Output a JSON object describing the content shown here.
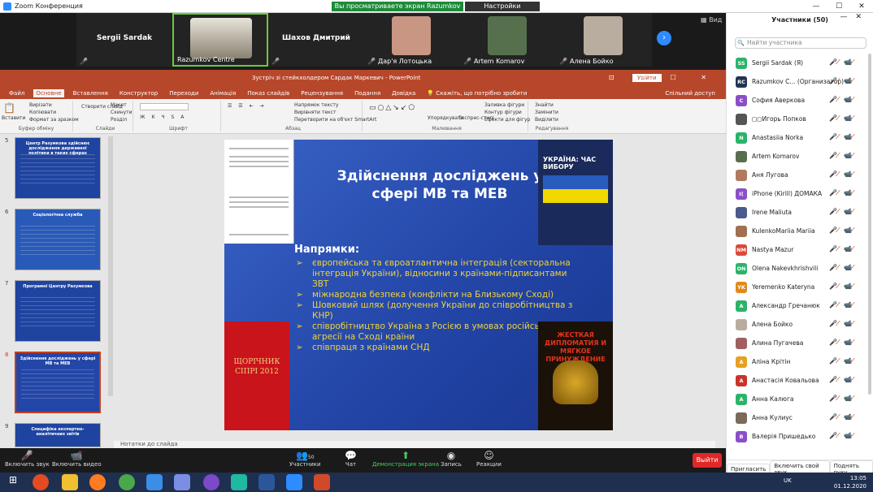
{
  "window": {
    "title": "Zoom Конференция",
    "controls": [
      "—",
      "☐",
      "✕"
    ]
  },
  "share_banner": "Вы просматриваете экран Razumkov Centre",
  "view_options": "Настройки просмотра ⌄",
  "view_button": "Вид",
  "gallery": [
    {
      "name": "Sergii Sardak",
      "label": "",
      "mic_off": true,
      "photo": false
    },
    {
      "name": "",
      "label": "Razumkov Centre",
      "mic_off": false,
      "photo": true,
      "color": "#6a6a60"
    },
    {
      "name": "Шахов Дмитрий",
      "label": "",
      "mic_off": true,
      "photo": false
    },
    {
      "name": "",
      "label": "Дар'я Лотоцька",
      "mic_off": true,
      "photo": true,
      "color": "#c99683"
    },
    {
      "name": "",
      "label": "Artem Komarov",
      "mic_off": true,
      "photo": true,
      "color": "#56704e"
    },
    {
      "name": "",
      "label": "Алена Бойко",
      "mic_off": true,
      "photo": true,
      "color": "#b9ad9f"
    }
  ],
  "ppt": {
    "title": "Зустріч зі стейкхолдером Сардак Маркевич  -  PowerPoint",
    "login": "Увійти",
    "window_controls": "⊡ — ☐ ✕",
    "tabs": [
      "Файл",
      "Основне",
      "Вставлення",
      "Конструктор",
      "Переходи",
      "Анімація",
      "Показ слайдів",
      "Рецензування",
      "Подання",
      "Довідка",
      "💡 Скажіть, що потрібно зробити"
    ],
    "active_tab": "Основне",
    "share_label": "Спільний доступ",
    "ribbon": {
      "clipboard": {
        "label": "Буфер обміну",
        "paste": "Вставити",
        "cut": "Вирізати",
        "copy": "Копіювати",
        "format": "Формат за зразком"
      },
      "slides": {
        "label": "Слайди",
        "new": "Створити слайд",
        "layout": "Макет",
        "reset": "Скинути",
        "section": "Розділ"
      },
      "font": {
        "label": "Шрифт"
      },
      "paragraph": {
        "label": "Абзац",
        "direction": "Напрямок тексту",
        "align": "Вирівняти текст",
        "smartart": "Перетворити на об'єкт SmartArt"
      },
      "drawing": {
        "label": "Малювання",
        "arrange": "Упорядкувати",
        "styles": "Експрес-стилі",
        "fill": "Заливка фігури",
        "outline": "Контур фігури",
        "effects": "Ефекти для фігур"
      },
      "editing": {
        "label": "Редагування",
        "find": "Знайти",
        "replace": "Замінити",
        "select": "Виділити"
      }
    },
    "thumbnails": [
      {
        "num": "5",
        "title": "Центр Разумкова здійснює дослідження державної політики в таких сферах",
        "selected": false,
        "bg": "#1f44a0"
      },
      {
        "num": "6",
        "title": "Соціологічна служба",
        "selected": false,
        "bg": "#2a5ab8"
      },
      {
        "num": "7",
        "title": "Програмні Центру Разумкова",
        "selected": false,
        "bg": "#1f44a0"
      },
      {
        "num": "8",
        "title": "Здійснення досліджень у сфері МВ та МЕВ",
        "selected": true,
        "bg": "#2346a8"
      },
      {
        "num": "9",
        "title": "Специфіка експертно-аналітичних звітів",
        "selected": false,
        "bg": "#1f44a0"
      }
    ],
    "notes": "Нотатки до слайда",
    "slide": {
      "title": "Здійснення досліджень у сфері МВ та МЕВ",
      "book1_title": "УКРАЇНА: ЧАС ВИБОРУ",
      "heading": "Напрямки:",
      "bullets": [
        "європейська та євроатлантична  інтеграція (секторальна інтеграція України), відносини з країнами-підписантами ЗВТ",
        "міжнародна безпека (конфлікти на Близькому Сході)",
        "Шовковий шлях (долучення України до співробітництва з КНР)",
        "співробітництво Україна з Росією в умовах російської агресії на Сході країни",
        "співпраця з країнами СНД"
      ],
      "book2_title": "ЩОРІЧНИК СІПРІ 2012",
      "book3_title": "ЖЕСТКАЯ ДИПЛОМАТИЯ И МЯГКОЕ ПРИНУЖДЕНИЕ"
    }
  },
  "participants": {
    "header": "Участники (50)",
    "search_placeholder": "Найти участника",
    "list": [
      {
        "initials": "SS",
        "name": "Sergii Sardak (Я)",
        "color": "#2bb36a"
      },
      {
        "initials": "RC",
        "name": "Razumkov C... (Организатор)",
        "color": "#223355"
      },
      {
        "initials": "C",
        "name": "София Аверкова",
        "color": "#8a4fc8"
      },
      {
        "initials": "",
        "name": "◻◻Игорь Попков",
        "color": "#555555"
      },
      {
        "initials": "N",
        "name": "Anastasiia Norka",
        "color": "#2bb36a"
      },
      {
        "initials": "",
        "name": "Artem Komarov",
        "color": "#56704e"
      },
      {
        "initials": "",
        "name": "Аня Лугова",
        "color": "#b07a60"
      },
      {
        "initials": "I(",
        "name": "iPhone (Kirill) ДОМАКА",
        "color": "#8a4fc8"
      },
      {
        "initials": "",
        "name": "Irene Maliuta",
        "color": "#4a5a8a"
      },
      {
        "initials": "",
        "name": "KulenkoMariia Mariia",
        "color": "#a07050"
      },
      {
        "initials": "NM",
        "name": "Nastya Mazur",
        "color": "#d94a3a"
      },
      {
        "initials": "ON",
        "name": "Olena Nakevkhrishvili",
        "color": "#2bb36a"
      },
      {
        "initials": "YK",
        "name": "Yeremenko Kateryna",
        "color": "#e08a1a"
      },
      {
        "initials": "A",
        "name": "Александр Гречанюк",
        "color": "#2bb36a"
      },
      {
        "initials": "",
        "name": "Алена Бойко",
        "color": "#b9ad9f"
      },
      {
        "initials": "",
        "name": "Алина Пугачева",
        "color": "#a06060"
      },
      {
        "initials": "A",
        "name": "Аліна Крітін",
        "color": "#e8a020"
      },
      {
        "initials": "A",
        "name": "Анастасія Ковальова",
        "color": "#c8342a"
      },
      {
        "initials": "A",
        "name": "Анна Калюга",
        "color": "#2bb36a"
      },
      {
        "initials": "",
        "name": "Анна Кулиус",
        "color": "#7a6a5a"
      },
      {
        "initials": "B",
        "name": "Валерія Пришедько",
        "color": "#8a4fc8"
      }
    ],
    "buttons": [
      "Пригласить",
      "Включить свой звук",
      "Поднять руку"
    ]
  },
  "toolbar": {
    "unmute": "Включить звук",
    "start_video": "Включить видео",
    "participants": "Участники",
    "participants_count": "50",
    "chat": "Чат",
    "share": "Демонстрация экрана",
    "record": "Запись",
    "reactions": "Реакции",
    "end": "Выйти"
  },
  "taskbar": {
    "lang": "UK",
    "time": "13:05",
    "date": "01.12.2020"
  }
}
